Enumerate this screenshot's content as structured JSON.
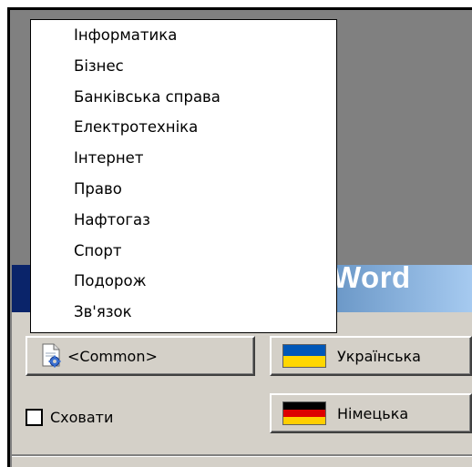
{
  "dropdown": {
    "items": [
      "Інформатика",
      "Бізнес",
      "Банківська справа",
      "Електротехніка",
      "Інтернет",
      "Право",
      "Нафтогаз",
      "Спорт",
      "Подорож",
      "Зв'язок"
    ]
  },
  "banner": {
    "title": "Word"
  },
  "buttons": {
    "common": {
      "label": "<Common>",
      "icon": "document-gear-icon"
    },
    "ukrainian": {
      "label": "Українська",
      "flag": [
        "#0057b8",
        "#ffd700"
      ]
    },
    "german": {
      "label": "Німецька",
      "flag": [
        "#000000",
        "#dd0000",
        "#ffce00"
      ]
    }
  },
  "checkbox": {
    "label": "Сховати",
    "checked": false
  },
  "colors": {
    "panel": "#d4d0c8",
    "dark_area": "#808080",
    "banner_start": "#0a246a",
    "banner_end": "#a6caf0"
  }
}
